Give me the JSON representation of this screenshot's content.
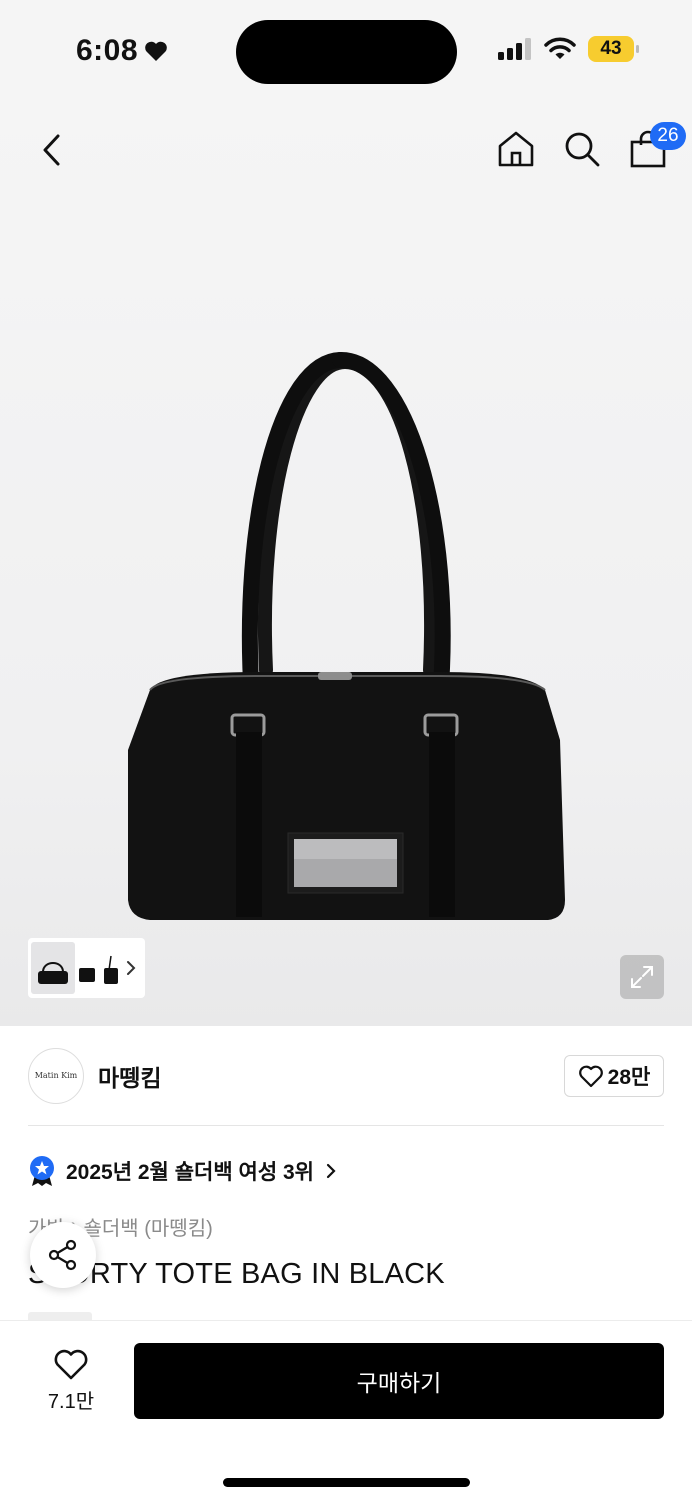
{
  "status": {
    "time": "6:08",
    "battery": "43"
  },
  "nav": {
    "cart_count": "26"
  },
  "gallery": {
    "thumbnail_count": 3
  },
  "brand": {
    "logo_text": "Matin  Kim",
    "name": "마뗑킴",
    "likes": "28만"
  },
  "product": {
    "ranking": "2025년 2월 숄더백 여성 3위",
    "breadcrumb": [
      "가방",
      "숄더백 (마뗑킴)"
    ],
    "breadcrumb_sep": "›",
    "title": "SPORTY TOTE BAG IN BLACK"
  },
  "bottom": {
    "wish_count": "7.1만",
    "buy_label": "구매하기"
  },
  "colors": {
    "accent": "#1f6bf5",
    "battery": "#f7cc2f",
    "primary_button": "#000000"
  }
}
